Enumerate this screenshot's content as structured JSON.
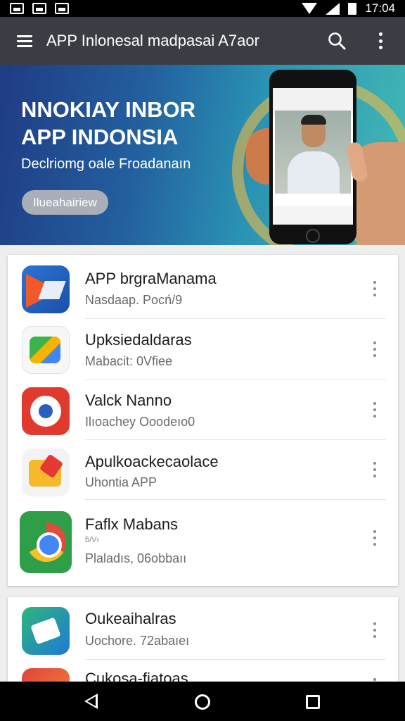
{
  "status_bar": {
    "time": "17:04"
  },
  "app_bar": {
    "title": "APP Inlonesal madpasai A7aor"
  },
  "banner": {
    "title_line1": "NNOKIAY INBOR",
    "title_line2": "APP INDONSIA",
    "subtitle": "Declriomg oale Froadanaın",
    "button_label": "Ilueahairiew"
  },
  "apps": [
    {
      "name": "APP brgraManama",
      "subtitle": "Nasdaap. Pocń/9",
      "icon": "app-icon-blue-arrow"
    },
    {
      "name": "Upksiedaldaras",
      "subtitle": "Mabacit: 0Vfiee",
      "icon": "app-icon-green-tile"
    },
    {
      "name": "Valck Nanno",
      "subtitle": "Ilıoachey Ooodeıo0",
      "icon": "app-icon-red-target"
    },
    {
      "name": "Apulkoackecaolace",
      "subtitle": "Uhontia APP",
      "icon": "app-icon-yellow-tag"
    },
    {
      "name": "Faflx Mabans",
      "extra": "ƃ/Vı",
      "subtitle": "Plaladıs, 06obbaıı",
      "icon": "app-icon-chrome"
    },
    {
      "name": "Oukeaihalras",
      "subtitle": "Uochore. 72abaıeı",
      "icon": "app-icon-teal-house"
    },
    {
      "name": "Cukosa-fiatoas",
      "subtitle": "",
      "icon": "app-icon-orange"
    }
  ]
}
